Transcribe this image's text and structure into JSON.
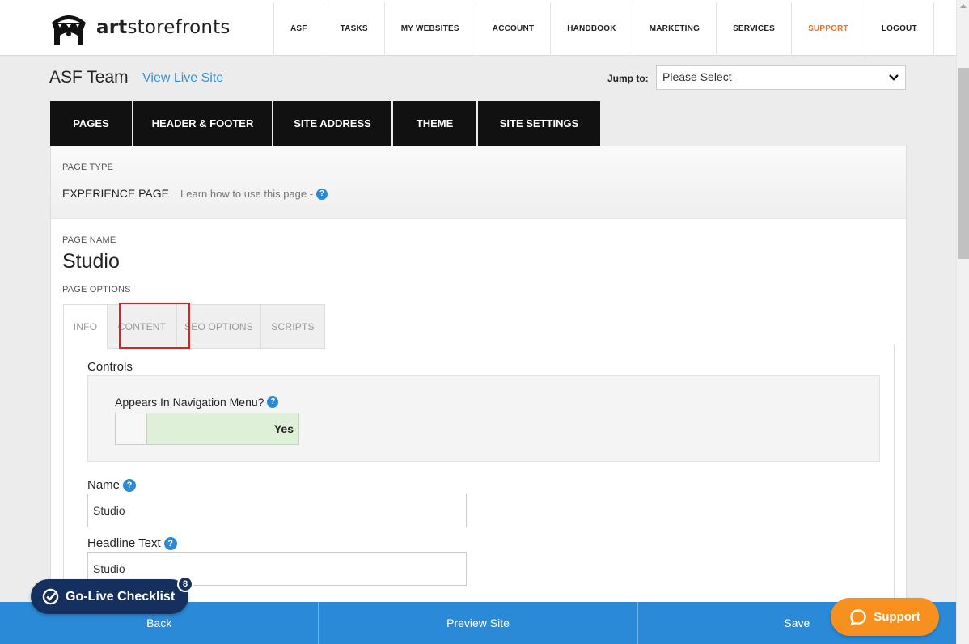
{
  "brand": {
    "logo_text_bold": "art",
    "logo_text_rest": "storefronts"
  },
  "nav": {
    "items": [
      {
        "label": "ASF"
      },
      {
        "label": "TASKS"
      },
      {
        "label": "MY WEBSITES"
      },
      {
        "label": "ACCOUNT"
      },
      {
        "label": "HANDBOOK"
      },
      {
        "label": "MARKETING"
      },
      {
        "label": "SERVICES"
      },
      {
        "label": "SUPPORT"
      },
      {
        "label": "LOGOUT"
      }
    ],
    "support_color": "#f26e1f"
  },
  "header": {
    "site_title": "ASF Team",
    "view_live_label": "View Live Site",
    "jump_label": "Jump to:",
    "jump_select_value": "Please Select"
  },
  "main_tabs": [
    {
      "label": "PAGES"
    },
    {
      "label": "HEADER & FOOTER"
    },
    {
      "label": "SITE ADDRESS"
    },
    {
      "label": "THEME"
    },
    {
      "label": "SITE SETTINGS"
    }
  ],
  "page": {
    "page_type_label": "PAGE TYPE",
    "page_type_value": "EXPERIENCE PAGE",
    "learn_link": "Learn how to use this page -",
    "page_name_label": "PAGE NAME",
    "page_name": "Studio",
    "page_options_label": "PAGE OPTIONS"
  },
  "sub_tabs": [
    {
      "label": "INFO"
    },
    {
      "label": "CONTENT"
    },
    {
      "label": "SEO OPTIONS"
    },
    {
      "label": "SCRIPTS"
    }
  ],
  "form": {
    "controls_title": "Controls",
    "nav_question": "Appears In Navigation Menu?",
    "nav_toggle_value": "Yes",
    "name_label": "Name",
    "name_value": "Studio",
    "headline_label": "Headline Text",
    "headline_value": "Studio"
  },
  "bottom_bar": {
    "back_label": "Back",
    "preview_label": "Preview Site",
    "save_label": "Save"
  },
  "golive": {
    "label": "Go-Live Checklist",
    "badge": "8"
  },
  "support_widget": {
    "label": "Support"
  },
  "colors": {
    "accent_blue": "#2a8ad8",
    "support_orange": "#f7901e",
    "dark_navy": "#15305e"
  }
}
